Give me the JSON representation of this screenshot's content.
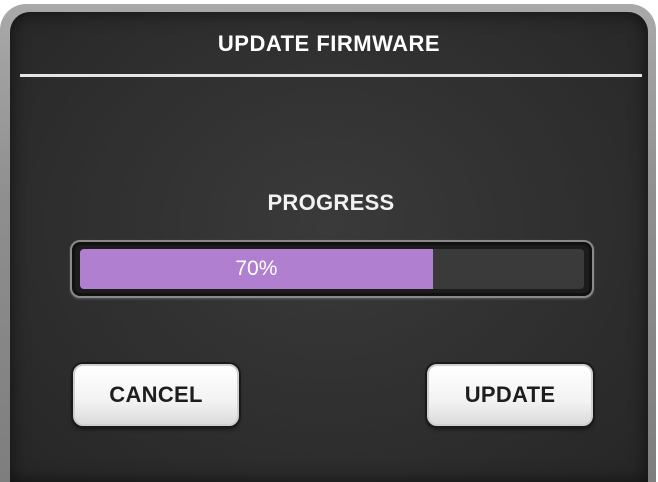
{
  "dialog": {
    "title": "UPDATE FIRMWARE"
  },
  "progress": {
    "label": "PROGRESS",
    "value_percent": 70,
    "value_text": "70%",
    "fill_color": "#b07fd0",
    "track_color": "#3a3a3a"
  },
  "buttons": {
    "cancel_label": "CANCEL",
    "update_label": "UPDATE"
  },
  "colors": {
    "background": "#2f2f2f",
    "text": "#ffffff",
    "button_text": "#1e1e1e"
  }
}
